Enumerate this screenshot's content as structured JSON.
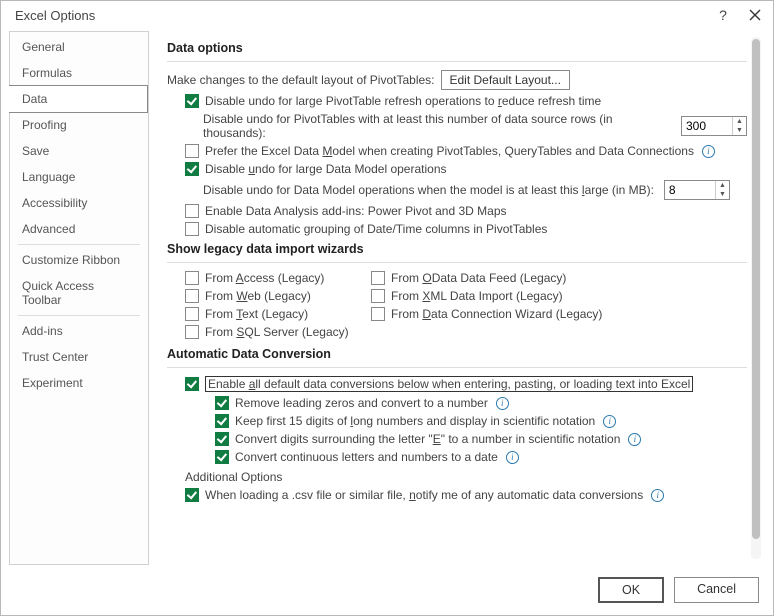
{
  "title": "Excel Options",
  "sidebar": {
    "items": [
      "General",
      "Formulas",
      "Data",
      "Proofing",
      "Save",
      "Language",
      "Accessibility",
      "Advanced",
      "Customize Ribbon",
      "Quick Access Toolbar",
      "Add-ins",
      "Trust Center",
      "Experiment"
    ],
    "selected_index": 2
  },
  "section_data_options": {
    "title": "Data options",
    "pivot_layout_label": "Make changes to the default layout of PivotTables:",
    "edit_layout_button": "Edit Default Layout...",
    "disable_undo_pivot": {
      "checked": true,
      "label_html": "Disable undo for large PivotTable refresh operations to <u>r</u>educe refresh time"
    },
    "disable_undo_rows": {
      "label": "Disable undo for PivotTables with at least this number of data source rows (in thousands):",
      "value": "300"
    },
    "prefer_data_model": {
      "checked": false,
      "label_html": "Prefer the Excel Data <u>M</u>odel when creating PivotTables, QueryTables and Data Connections"
    },
    "disable_undo_dm": {
      "checked": true,
      "label_html": "Disable <u>u</u>ndo for large Data Model operations"
    },
    "disable_undo_dm_size": {
      "label_html": "Disable undo for Data Model operations when the model is at least this <u>l</u>arge (in MB):",
      "value": "8"
    },
    "enable_addins": {
      "checked": false,
      "label": "Enable Data Analysis add-ins: Power Pivot and 3D Maps"
    },
    "disable_autogroup": {
      "checked": false,
      "label": "Disable automatic grouping of Date/Time columns in PivotTables"
    }
  },
  "section_legacy": {
    "title": "Show legacy data import wizards",
    "items": [
      {
        "checked": false,
        "label_html": "From <u>A</u>ccess (Legacy)"
      },
      {
        "checked": false,
        "label_html": "From <u>O</u>Data Data Feed (Legacy)"
      },
      {
        "checked": false,
        "label_html": "From <u>W</u>eb (Legacy)"
      },
      {
        "checked": false,
        "label_html": "From <u>X</u>ML Data Import (Legacy)"
      },
      {
        "checked": false,
        "label_html": "From <u>T</u>ext (Legacy)"
      },
      {
        "checked": false,
        "label_html": "From <u>D</u>ata Connection Wizard (Legacy)"
      },
      {
        "checked": false,
        "label_html": "From <u>S</u>QL Server (Legacy)"
      }
    ]
  },
  "section_auto_convert": {
    "title": "Automatic Data Conversion",
    "enable_all": {
      "checked": true,
      "label_html": "Enable <u>a</u>ll default data conversions below when entering, pasting, or loading text into Excel"
    },
    "remove_zeros": {
      "checked": true,
      "label": "Remove leading zeros and convert to a number"
    },
    "keep_15": {
      "checked": true,
      "label_html": "Keep first 15 digits of <u>l</u>ong numbers and display in scientific notation"
    },
    "convert_e": {
      "checked": true,
      "label_html": "Convert digits surrounding the letter \"<u>E</u>\" to a number in scientific notation"
    },
    "convert_date": {
      "checked": true,
      "label": "Convert continuous letters and numbers to a date"
    },
    "additional_title": "Additional Options",
    "csv_notify": {
      "checked": true,
      "label_html": "When loading a .csv file or similar file, <u>n</u>otify me of any automatic data conversions"
    }
  },
  "buttons": {
    "ok": "OK",
    "cancel": "Cancel"
  }
}
